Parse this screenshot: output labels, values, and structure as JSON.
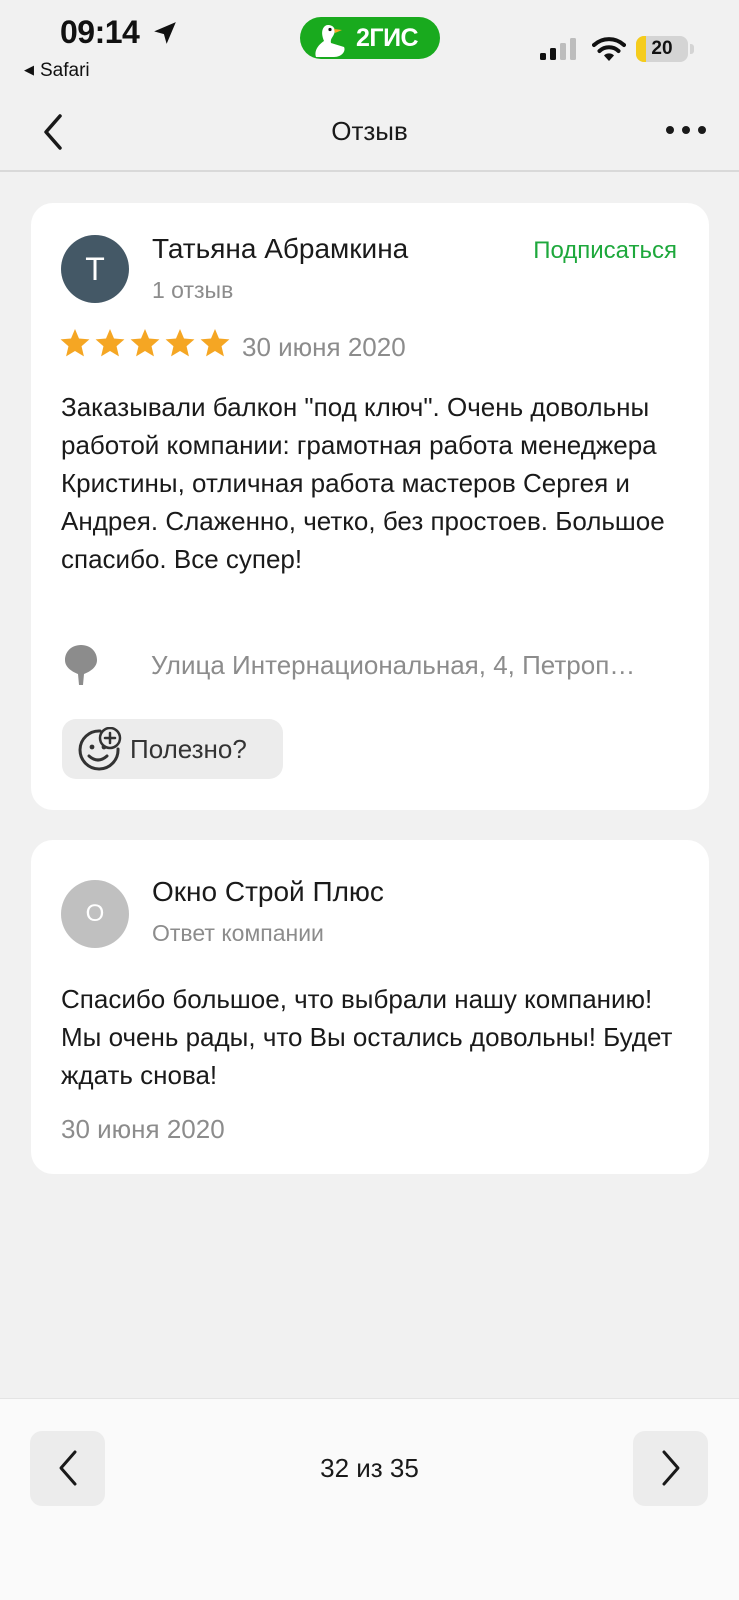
{
  "status_bar": {
    "time": "09:14",
    "back_app": "Safari",
    "brand": "2ГИС",
    "battery_level": "20",
    "battery_fraction": 0.2
  },
  "header": {
    "title": "Отзыв"
  },
  "review": {
    "author_initial": "Т",
    "author_name": "Татьяна Абрамкина",
    "author_reviews": "1 отзыв",
    "subscribe_label": "Подписаться",
    "rating": 5,
    "date": "30 июня 2020",
    "text": "Заказывали балкон \"под ключ\". Очень довольны работой компании: грамотная работа менеджера Кристины, отличная работа мастеров Сергея и Андрея. Слаженно, четко, без простоев. Большое спасибо. Все супер!",
    "address": "Улица Интернациональная, 4, Петроп…",
    "useful_label": "Полезно?"
  },
  "reply": {
    "author_initial": "О",
    "author_name": "Окно Строй Плюс",
    "role": "Ответ компании",
    "text": "Спасибо большое, что выбрали нашу компанию! Мы очень рады, что Вы остались довольны! Будет ждать снова!",
    "date": "30 июня 2020"
  },
  "pager": {
    "counter": "32 из 35"
  },
  "colors": {
    "accent_green": "#1ea83c",
    "brand_green": "#19aa1e",
    "star": "#f5a623",
    "background": "#f1f1f1",
    "muted_text": "#8c8c8c"
  },
  "icons": {
    "location": "location-arrow-icon",
    "back": "chevron-left-icon",
    "more": "more-dots-icon",
    "star": "star-icon",
    "pin": "map-pin-icon",
    "useful": "smiley-plus-icon",
    "prev": "chevron-left-icon",
    "next": "chevron-right-icon"
  }
}
